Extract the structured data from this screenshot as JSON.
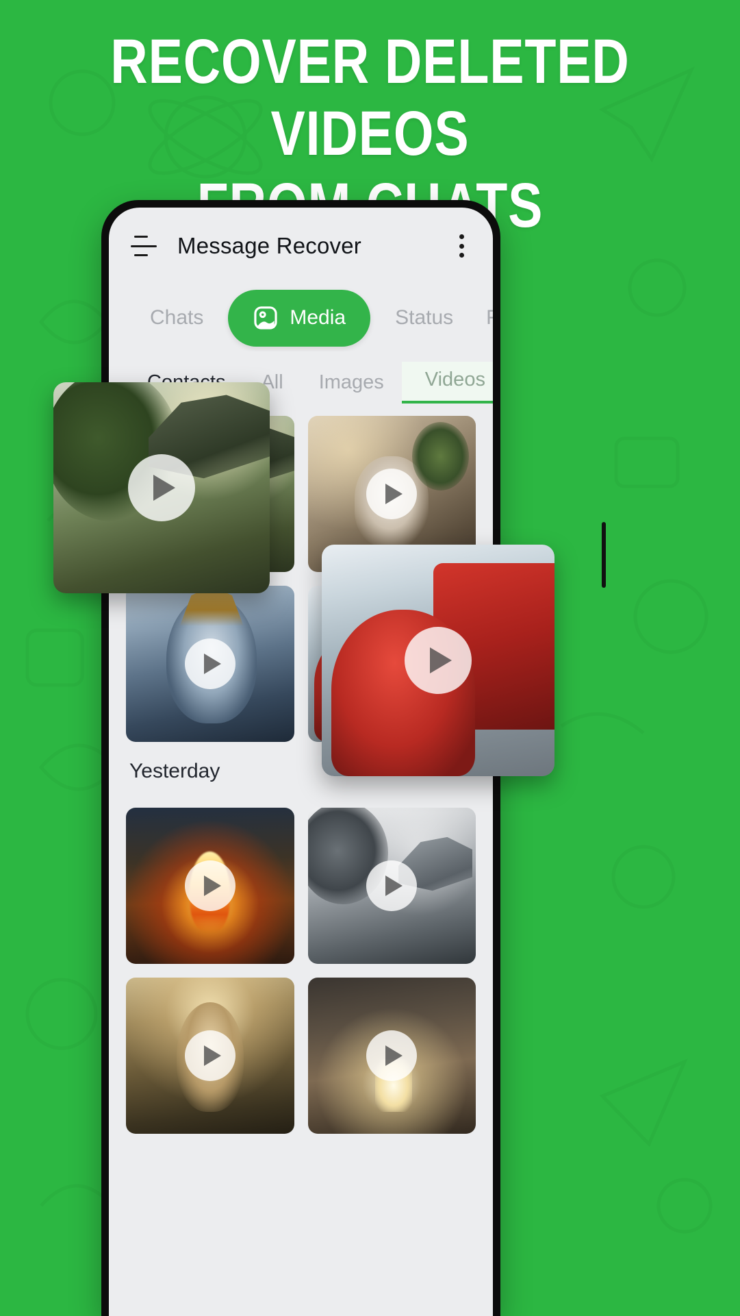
{
  "poster": {
    "background_color": "#2CB742",
    "headline_line1": "RECOVER DELETED VIDEOS",
    "headline_line2": "FROM CHATS",
    "headline_color": "#FFFFFF"
  },
  "appbar": {
    "menu_icon": "hamburger-icon",
    "title": "Message Recover",
    "overflow_icon": "three-dot-menu-icon"
  },
  "tabs": {
    "accent_color": "#33B44A",
    "inactive_color": "#A7AAAF",
    "items": [
      {
        "label": "Chats",
        "active": false,
        "icon": ""
      },
      {
        "label": "Media",
        "active": true,
        "icon": "image-icon"
      },
      {
        "label": "Status",
        "active": false,
        "icon": ""
      },
      {
        "label": "Favo",
        "active": false,
        "icon": ""
      }
    ]
  },
  "subtabs": {
    "selected_bg": "#F0F8F1",
    "underline_color": "#33B44A",
    "items": [
      {
        "label": "Contacts",
        "state": "dark"
      },
      {
        "label": "All",
        "state": "normal"
      },
      {
        "label": "Images",
        "state": "normal"
      },
      {
        "label": "Videos",
        "state": "selected"
      }
    ]
  },
  "media": {
    "play_icon": "play-icon",
    "sections": [
      {
        "label": "",
        "thumbnails": [
          {
            "name": "video-thumb-garden",
            "art": "art-garden"
          },
          {
            "name": "video-thumb-kettle",
            "art": "art-kettle"
          },
          {
            "name": "video-thumb-mural",
            "art": "art-mural"
          },
          {
            "name": "video-thumb-train",
            "art": "art-train"
          }
        ]
      },
      {
        "label": "Yesterday",
        "thumbnails": [
          {
            "name": "video-thumb-bonfire",
            "art": "art-fire"
          },
          {
            "name": "video-thumb-bw-temple",
            "art": "art-bw"
          },
          {
            "name": "video-thumb-portrait",
            "art": "art-portrait"
          },
          {
            "name": "video-thumb-gift",
            "art": "art-gift"
          }
        ]
      }
    ],
    "floating_cards": [
      {
        "name": "floating-video-card-garden",
        "art": "art-garden",
        "class": "fc-garden"
      },
      {
        "name": "floating-video-card-train",
        "art": "art-train",
        "class": "fc-train"
      }
    ]
  }
}
